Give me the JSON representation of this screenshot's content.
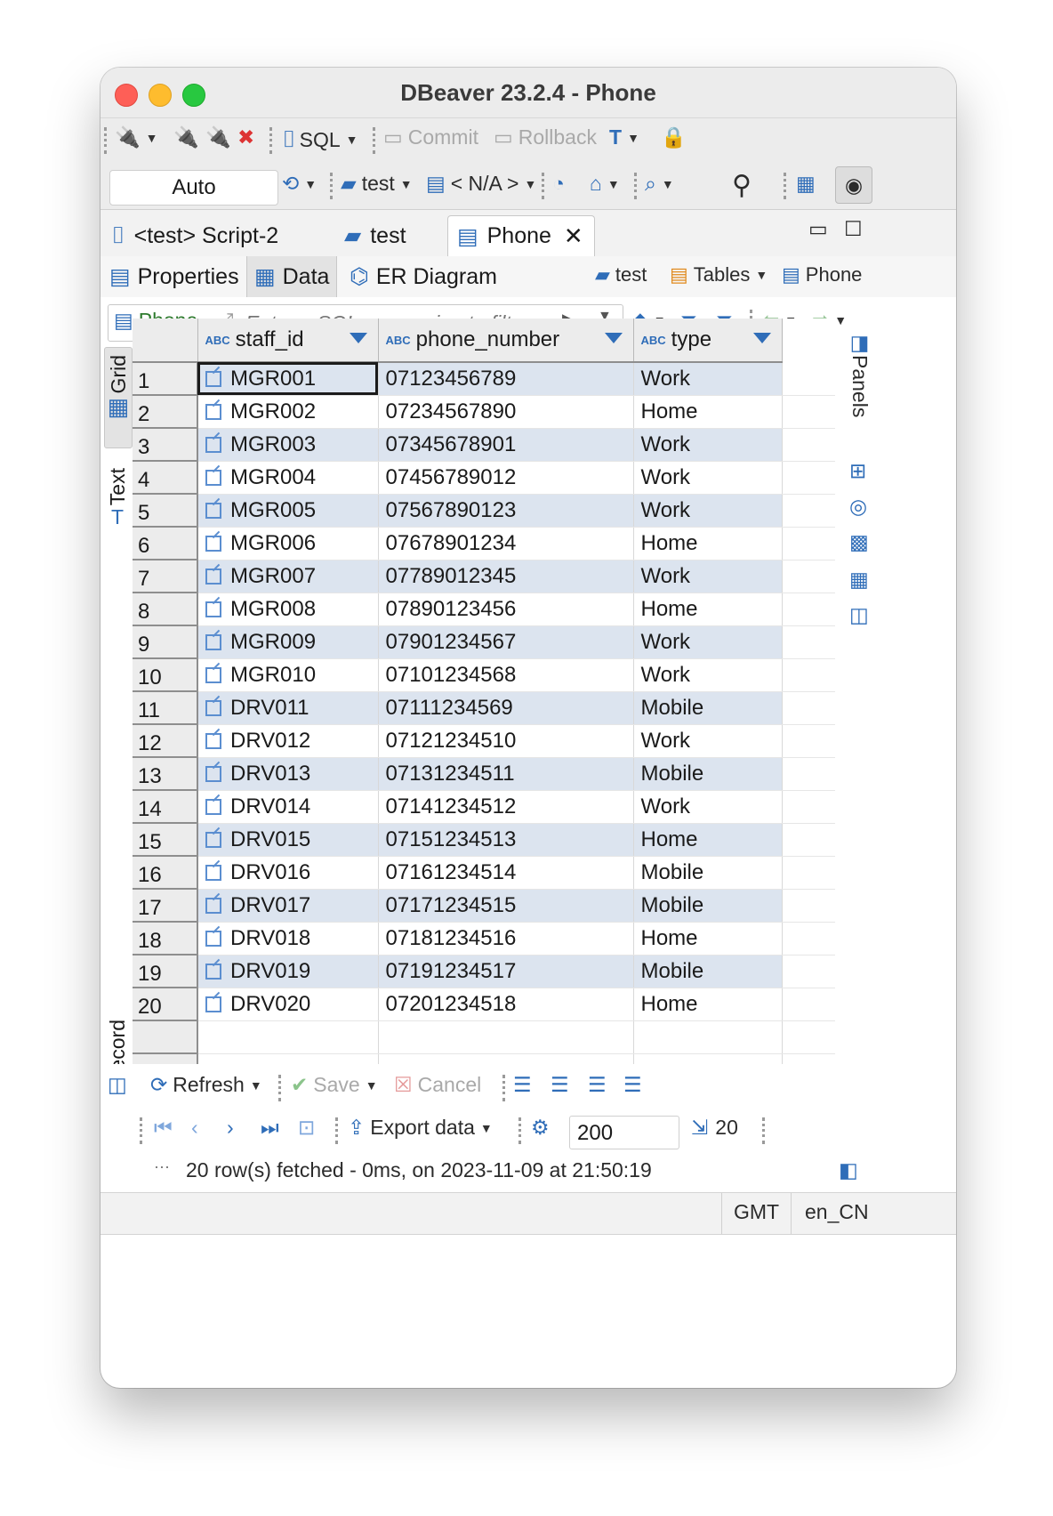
{
  "window": {
    "title": "DBeaver 23.2.4 - Phone"
  },
  "toolbar": {
    "sql_label": "SQL",
    "commit_label": "Commit",
    "rollback_label": "Rollback",
    "transaction_mode": "Auto",
    "datasource": "test",
    "schema": "< N/A >"
  },
  "editor_tabs": [
    {
      "label": "<test> Script-2"
    },
    {
      "label": "test"
    },
    {
      "label": "Phone"
    }
  ],
  "sub_tabs": [
    {
      "label": "Properties"
    },
    {
      "label": "Data"
    },
    {
      "label": "ER Diagram"
    }
  ],
  "breadcrumb": {
    "connection": "test",
    "folder": "Tables",
    "table": "Phone"
  },
  "filter": {
    "table_label": "Phone",
    "placeholder": "Enter a SQL expression to filte"
  },
  "side_tabs": {
    "grid": "Grid",
    "text": "Text",
    "record": "Record",
    "panels": "Panels"
  },
  "grid": {
    "columns": [
      {
        "type_badge": "ABC",
        "name": "staff_id"
      },
      {
        "type_badge": "ABC",
        "name": "phone_number"
      },
      {
        "type_badge": "ABC",
        "name": "type"
      }
    ],
    "rows": [
      {
        "n": "1",
        "staff_id": "MGR001",
        "phone_number": "07123456789",
        "type": "Work"
      },
      {
        "n": "2",
        "staff_id": "MGR002",
        "phone_number": "07234567890",
        "type": "Home"
      },
      {
        "n": "3",
        "staff_id": "MGR003",
        "phone_number": "07345678901",
        "type": "Work"
      },
      {
        "n": "4",
        "staff_id": "MGR004",
        "phone_number": "07456789012",
        "type": "Work"
      },
      {
        "n": "5",
        "staff_id": "MGR005",
        "phone_number": "07567890123",
        "type": "Work"
      },
      {
        "n": "6",
        "staff_id": "MGR006",
        "phone_number": "07678901234",
        "type": "Home"
      },
      {
        "n": "7",
        "staff_id": "MGR007",
        "phone_number": "07789012345",
        "type": "Work"
      },
      {
        "n": "8",
        "staff_id": "MGR008",
        "phone_number": "07890123456",
        "type": "Home"
      },
      {
        "n": "9",
        "staff_id": "MGR009",
        "phone_number": "07901234567",
        "type": "Work"
      },
      {
        "n": "10",
        "staff_id": "MGR010",
        "phone_number": "07101234568",
        "type": "Work"
      },
      {
        "n": "11",
        "staff_id": "DRV011",
        "phone_number": "07111234569",
        "type": "Mobile"
      },
      {
        "n": "12",
        "staff_id": "DRV012",
        "phone_number": "07121234510",
        "type": "Work"
      },
      {
        "n": "13",
        "staff_id": "DRV013",
        "phone_number": "07131234511",
        "type": "Mobile"
      },
      {
        "n": "14",
        "staff_id": "DRV014",
        "phone_number": "07141234512",
        "type": "Work"
      },
      {
        "n": "15",
        "staff_id": "DRV015",
        "phone_number": "07151234513",
        "type": "Home"
      },
      {
        "n": "16",
        "staff_id": "DRV016",
        "phone_number": "07161234514",
        "type": "Mobile"
      },
      {
        "n": "17",
        "staff_id": "DRV017",
        "phone_number": "07171234515",
        "type": "Mobile"
      },
      {
        "n": "18",
        "staff_id": "DRV018",
        "phone_number": "07181234516",
        "type": "Home"
      },
      {
        "n": "19",
        "staff_id": "DRV019",
        "phone_number": "07191234517",
        "type": "Mobile"
      },
      {
        "n": "20",
        "staff_id": "DRV020",
        "phone_number": "07201234518",
        "type": "Home"
      }
    ]
  },
  "actions": {
    "refresh": "Refresh",
    "save": "Save",
    "cancel": "Cancel",
    "export": "Export data",
    "fetch_size": "200",
    "row_count": "20"
  },
  "status": {
    "message": "20 row(s) fetched - 0ms, on 2023-11-09 at 21:50:19",
    "timezone": "GMT",
    "locale": "en_CN"
  },
  "colors": {
    "accent": "#2f6db8",
    "odd_row": "#dce4ef"
  }
}
